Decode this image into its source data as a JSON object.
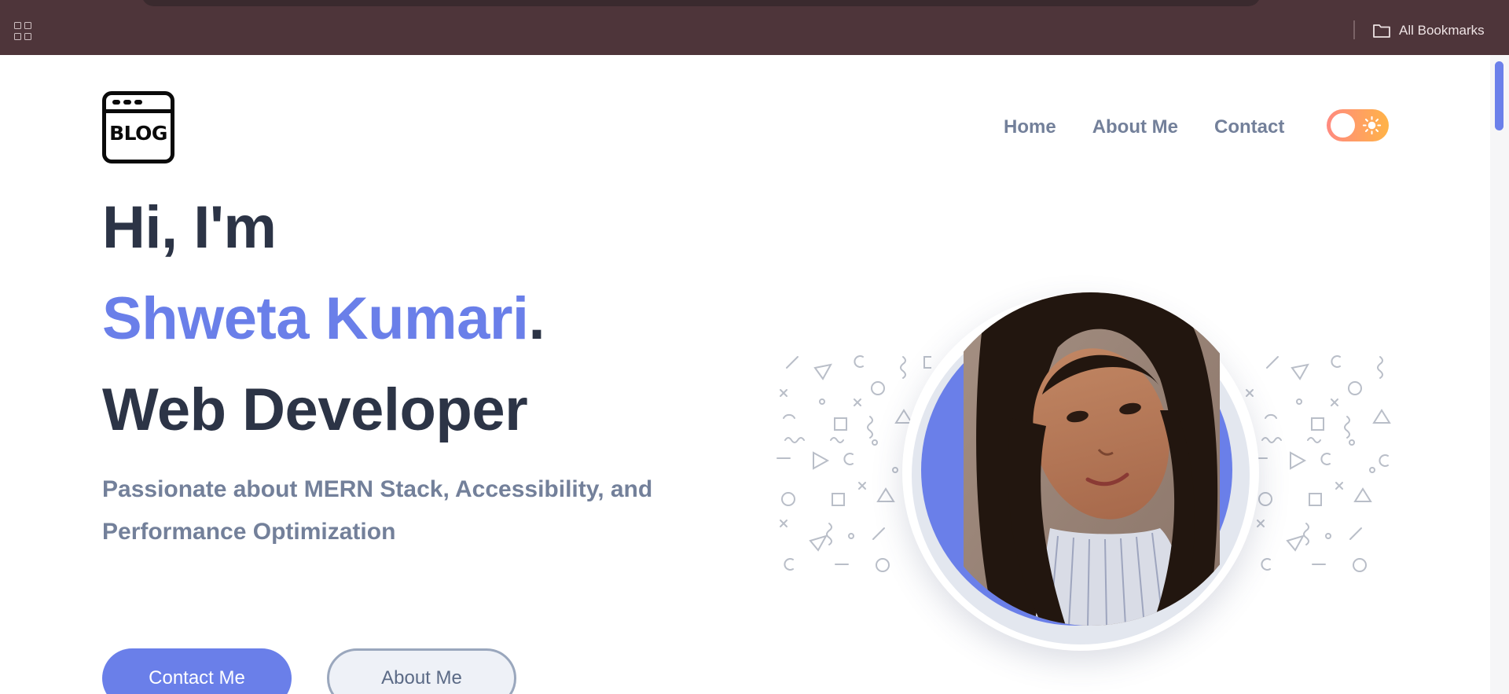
{
  "browser": {
    "bookmarks_label": "All Bookmarks",
    "icons": {
      "apps": "apps-grid-icon",
      "folder": "folder-icon"
    }
  },
  "header": {
    "logo_text": "BLOG",
    "nav": [
      {
        "label": "Home"
      },
      {
        "label": "About Me"
      },
      {
        "label": "Contact"
      }
    ],
    "theme_toggle": {
      "icon": "sun-icon",
      "state": "light"
    }
  },
  "hero": {
    "greeting": "Hi, I'm",
    "name": "Shweta Kumari",
    "name_suffix": ".",
    "role": "Web Developer",
    "tagline": "Passionate about MERN Stack, Accessibility, and Performance Optimization",
    "primary_button": "Contact Me",
    "secondary_button": "About Me"
  },
  "colors": {
    "accent": "#6a7fe9",
    "heading": "#2c3446",
    "muted": "#73809a",
    "browser_bar": "#4e353a",
    "toggle_gradient_start": "#ff8a80",
    "toggle_gradient_end": "#ffb347"
  }
}
